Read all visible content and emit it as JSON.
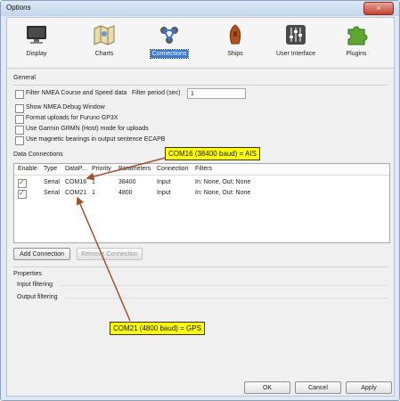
{
  "window": {
    "title": "Options",
    "close_glyph": "×"
  },
  "toolbar": {
    "items": [
      {
        "label": "Display",
        "icon": "monitor-icon"
      },
      {
        "label": "Charts",
        "icon": "charts-icon"
      },
      {
        "label": "Connections",
        "icon": "connections-icon",
        "active": true
      },
      {
        "label": "Ships",
        "icon": "ship-icon"
      },
      {
        "label": "User Interface",
        "icon": "sliders-icon"
      },
      {
        "label": "Plugins",
        "icon": "puzzle-icon"
      }
    ]
  },
  "general": {
    "heading": "General",
    "filter_nmea": {
      "label": "Filter NMEA Course and Speed data",
      "checked": false
    },
    "filter_period": {
      "label": "Filter period (sec)",
      "value": "1"
    },
    "show_debug": {
      "label": "Show NMEA Debug Window",
      "checked": false
    },
    "furuno": {
      "label": "Format uploads for Furuno GP3X",
      "checked": false
    },
    "garmin": {
      "label": "Use Garmin GRMN (Host) mode for uploads",
      "checked": false
    },
    "magnetic": {
      "label": "Use magnetic bearings in output sentence ECAPB",
      "checked": false
    }
  },
  "connections": {
    "heading": "Data Connections",
    "columns": [
      "Enable",
      "Type",
      "DataP...",
      "Priority",
      "Parameters",
      "Connection",
      "Filters"
    ],
    "rows": [
      {
        "enabled": true,
        "type": "Serial",
        "port": "COM16",
        "priority": "1",
        "params": "38400",
        "connection": "Input",
        "filters": "In: None, Out: None"
      },
      {
        "enabled": true,
        "type": "Serial",
        "port": "COM21",
        "priority": "1",
        "params": "4800",
        "connection": "Input",
        "filters": "In: None, Out: None"
      }
    ],
    "add_button": "Add Connection",
    "remove_button": "Remove Connection"
  },
  "properties": {
    "heading": "Properties",
    "input_filtering": "Input filtering",
    "output_filtering": "Output filtering"
  },
  "annotations": {
    "ais": "COM16 (38400 baud) = AIS",
    "gps": "COM21 (4800 baud) = GPS",
    "color": "#ffff00",
    "arrow_color": "#a0522d"
  },
  "footer": {
    "ok": "OK",
    "cancel": "Cancel",
    "apply": "Apply"
  }
}
